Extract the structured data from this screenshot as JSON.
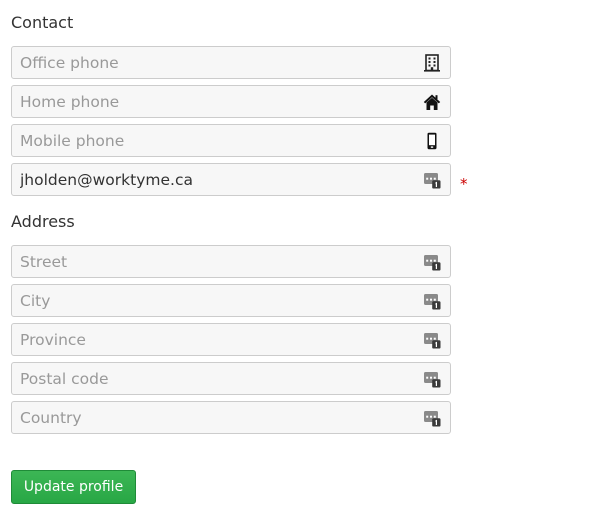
{
  "contact": {
    "heading": "Contact",
    "fields": [
      {
        "placeholder": "Office phone",
        "value": "",
        "icon": "building-icon"
      },
      {
        "placeholder": "Home phone",
        "value": "",
        "icon": "home-icon"
      },
      {
        "placeholder": "Mobile phone",
        "value": "",
        "icon": "mobile-phone-icon"
      },
      {
        "placeholder": "",
        "value": "jholden@worktyme.ca",
        "icon": "autofill-icon",
        "required": true
      }
    ],
    "required_marker": "*"
  },
  "address": {
    "heading": "Address",
    "fields": [
      {
        "placeholder": "Street",
        "value": "",
        "icon": "autofill-icon"
      },
      {
        "placeholder": "City",
        "value": "",
        "icon": "autofill-icon"
      },
      {
        "placeholder": "Province",
        "value": "",
        "icon": "autofill-icon"
      },
      {
        "placeholder": "Postal code",
        "value": "",
        "icon": "autofill-icon"
      },
      {
        "placeholder": "Country",
        "value": "",
        "icon": "autofill-icon"
      }
    ]
  },
  "update_button_label": "Update profile",
  "colors": {
    "button": "#28a745",
    "required": "#cc0000",
    "field_background": "#f7f7f7",
    "placeholder": "#999999"
  }
}
